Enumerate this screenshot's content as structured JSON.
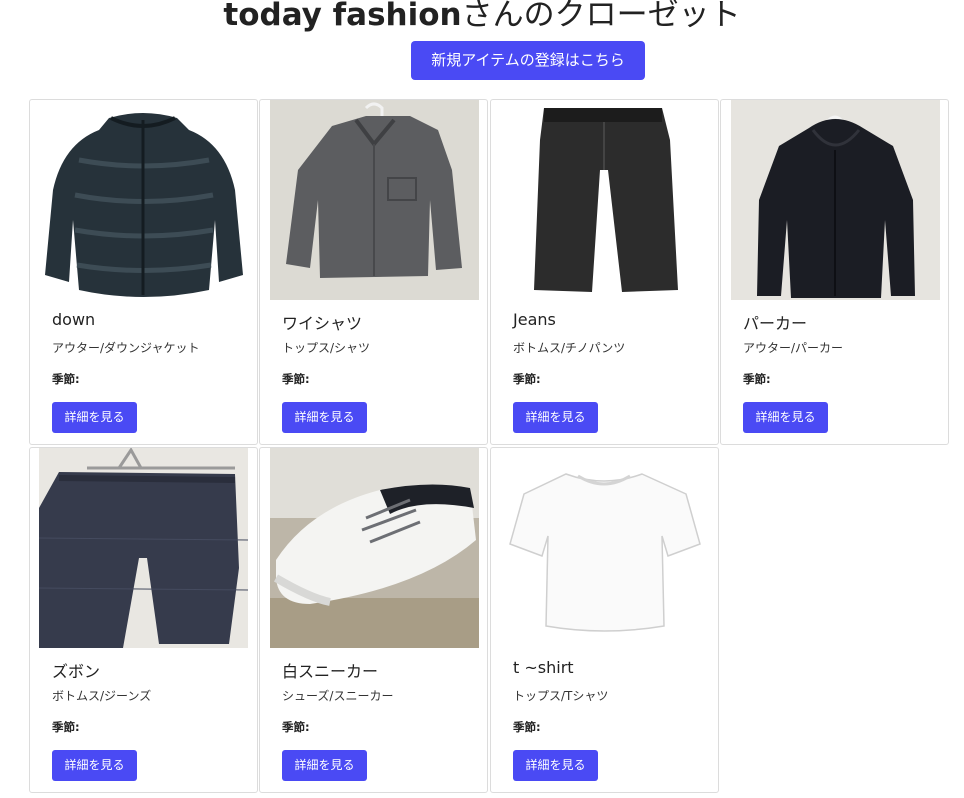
{
  "header": {
    "title_user": "today fashion",
    "title_suffix": "さんのクローゼット",
    "register_button": "新規アイテムの登録はこちら"
  },
  "season_label": "季節:",
  "detail_button": "詳細を見る",
  "items": [
    {
      "name": "down",
      "category": "アウター/ダウンジャケット",
      "image": "down-jacket"
    },
    {
      "name": "ワイシャツ",
      "category": "トップス/シャツ",
      "image": "gray-shirt"
    },
    {
      "name": "Jeans",
      "category": "ボトムス/チノパンツ",
      "image": "black-pants"
    },
    {
      "name": "パーカー",
      "category": "アウター/パーカー",
      "image": "black-hoodie"
    },
    {
      "name": "ズボン",
      "category": "ボトムス/ジーンズ",
      "image": "plaid-trousers"
    },
    {
      "name": "白スニーカー",
      "category": "シューズ/スニーカー",
      "image": "white-sneakers"
    },
    {
      "name": "t ~shirt",
      "category": "トップス/Tシャツ",
      "image": "white-tshirt"
    }
  ]
}
